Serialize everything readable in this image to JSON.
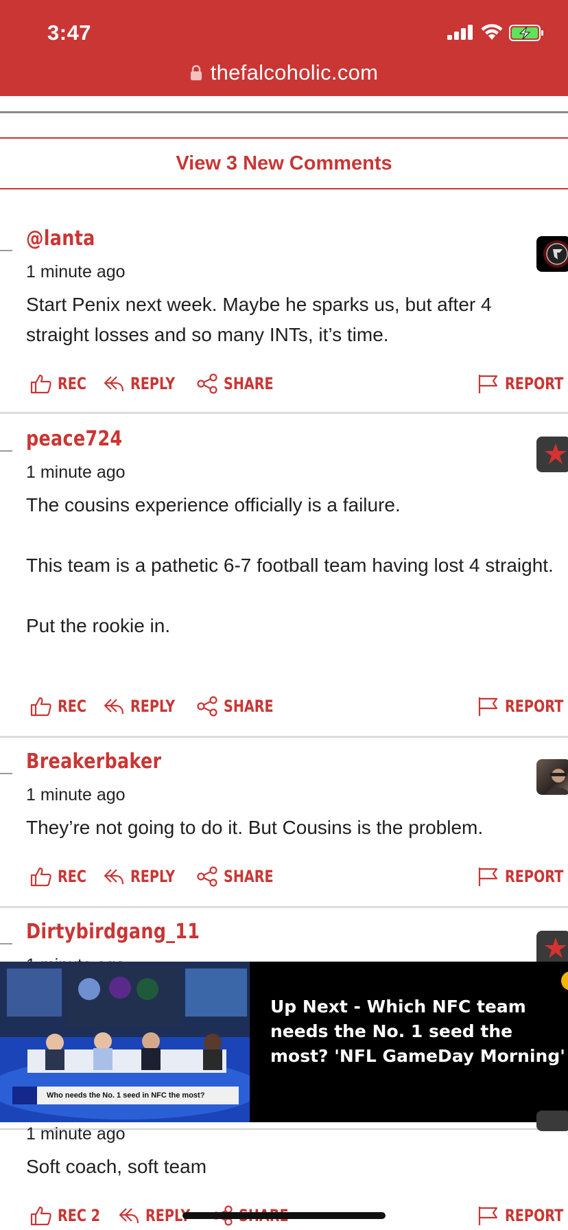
{
  "status_bar": {
    "time": "3:47"
  },
  "browser": {
    "url": "thefalcoholic.com"
  },
  "new_comments_label": "View 3 New Comments",
  "actions": {
    "rec": "REC",
    "reply": "REPLY",
    "share": "SHARE",
    "report": "REPORT"
  },
  "comments": [
    {
      "username": "@lanta",
      "time": "1 minute ago",
      "paragraphs": [
        "Start Penix next week. Maybe he sparks us, but after 4 straight losses and so many INTs, it’s time."
      ]
    },
    {
      "username": "peace724",
      "time": "1 minute ago",
      "paragraphs": [
        "The cousins experience officially is a failure.",
        "",
        "This team is a pathetic 6-7 football team having lost 4 straight.",
        "",
        "Put the rookie in."
      ]
    },
    {
      "username": "Breakerbaker",
      "time": "1 minute ago",
      "paragraphs": [
        "They’re not going to do it. But Cousins is the problem."
      ]
    },
    {
      "username": "Dirtybirdgang_11",
      "time": "1 minute ago",
      "paragraphs": []
    },
    {
      "time": "1 minute ago",
      "paragraphs": [
        "Soft coach, soft team"
      ],
      "rec_label": "REC 2"
    }
  ],
  "ad": {
    "title": "Up Next - Which NFC team needs the No. 1 seed the most? 'NFL GameDay Morning'",
    "caption": "Who needs the No. 1 seed in NFC the most?"
  },
  "colors": {
    "accent": "#c93634",
    "text": "#1f1f1f",
    "separator": "#dcdcdc"
  }
}
